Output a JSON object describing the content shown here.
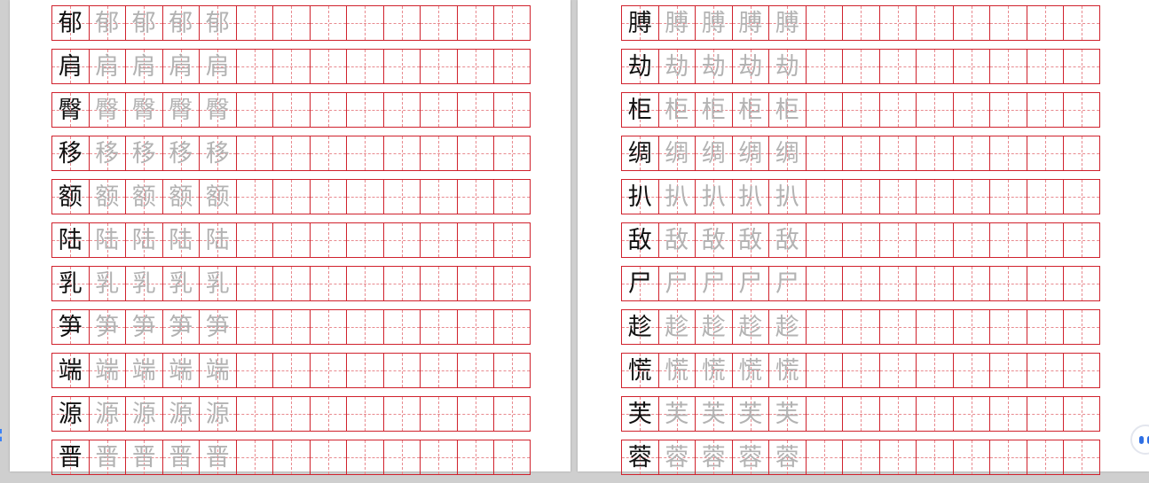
{
  "document": {
    "left_page": {
      "characters": [
        "郁",
        "肩",
        "臀",
        "移",
        "额",
        "陆",
        "乳",
        "笋",
        "端",
        "源",
        "晋"
      ]
    },
    "right_page": {
      "characters": [
        "膊",
        "劫",
        "柜",
        "绸",
        "扒",
        "敌",
        "尸",
        "趁",
        "慌",
        "芙",
        "蓉"
      ]
    },
    "grid": {
      "cells_per_row": 13,
      "trace_copies": 4,
      "border_color": "#d0222d",
      "guide_color": "#e88a8f",
      "trace_color": "#b3b3b3",
      "model_color": "#111111"
    }
  },
  "ui": {
    "left_float": "dashed-tab-icon",
    "right_float": "assistant-chat-icon"
  }
}
